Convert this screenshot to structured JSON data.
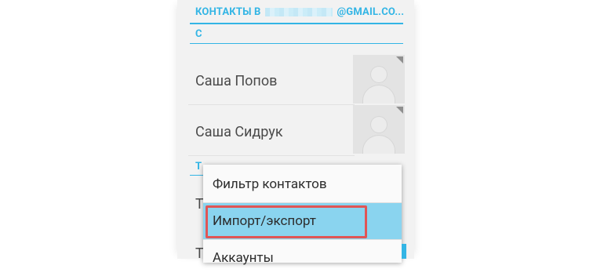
{
  "header": {
    "prefix": "КОНТАКТЫ В",
    "suffix": "@GMAIL.CO..."
  },
  "sections": [
    {
      "letter": "С"
    },
    {
      "letter": "Т"
    }
  ],
  "contacts": [
    {
      "name": "Саша Попов"
    },
    {
      "name": "Саша Сидрук"
    }
  ],
  "menu": {
    "items": [
      {
        "label": "Фильтр контактов"
      },
      {
        "label": "Импорт/экспорт"
      },
      {
        "label": "Аккаунты"
      }
    ]
  },
  "colors": {
    "accent": "#33b5e5",
    "selected": "#8ad4ef",
    "highlight": "#e05555"
  }
}
